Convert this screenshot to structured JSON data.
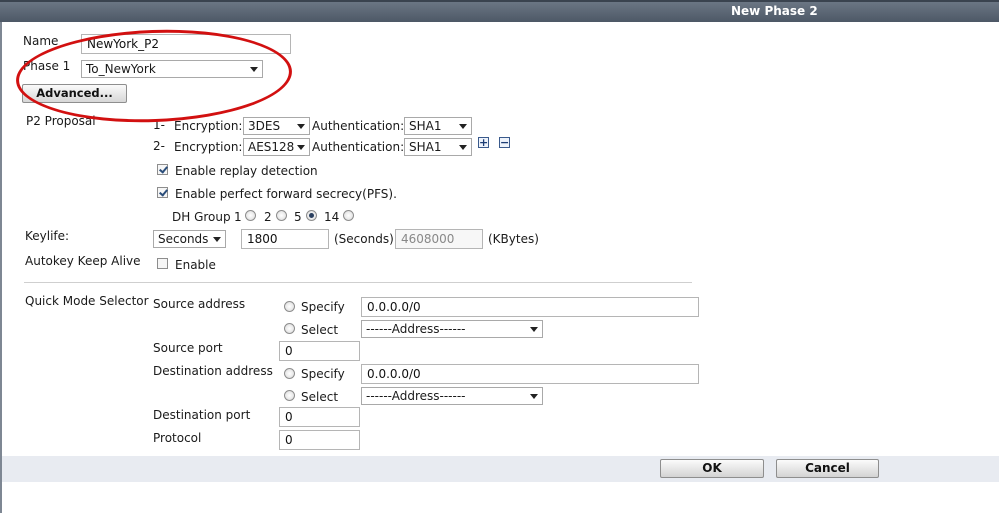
{
  "window": {
    "title": "New Phase 2"
  },
  "name": {
    "label": "Name",
    "value": "NewYork_P2"
  },
  "phase1": {
    "label": "Phase 1",
    "value": "To_NewYork"
  },
  "advanced_button": "Advanced...",
  "p2_proposal": {
    "label": "P2 Proposal",
    "rows": [
      {
        "index": "1-",
        "encryption_label": "Encryption:",
        "encryption": "3DES",
        "auth_label": "Authentication:",
        "auth": "SHA1"
      },
      {
        "index": "2-",
        "encryption_label": "Encryption:",
        "encryption": "AES128",
        "auth_label": "Authentication:",
        "auth": "SHA1"
      }
    ],
    "add_icon": "plus-box-icon",
    "remove_icon": "minus-box-icon"
  },
  "replay": {
    "label": "Enable replay detection",
    "checked": true
  },
  "pfs": {
    "label": "Enable perfect forward secrecy(PFS).",
    "checked": true
  },
  "dh_group": {
    "label": "DH Group",
    "options": [
      "1",
      "2",
      "5",
      "14"
    ],
    "selected": "5"
  },
  "keylife": {
    "label": "Keylife:",
    "unit": "Seconds",
    "seconds_value": "1800",
    "seconds_label": "(Seconds)",
    "kbytes_value": "4608000",
    "kbytes_label": "(KBytes)"
  },
  "autokey": {
    "label": "Autokey Keep Alive",
    "option_label": "Enable",
    "checked": false
  },
  "quick_mode": {
    "label": "Quick Mode Selector",
    "source_address": {
      "label": "Source address",
      "specify_label": "Specify",
      "specify_value": "0.0.0.0/0",
      "select_label": "Select",
      "select_value": "------Address------"
    },
    "source_port": {
      "label": "Source port",
      "value": "0"
    },
    "destination_address": {
      "label": "Destination address",
      "specify_label": "Specify",
      "specify_value": "0.0.0.0/0",
      "select_label": "Select",
      "select_value": "------Address------"
    },
    "destination_port": {
      "label": "Destination port",
      "value": "0"
    },
    "protocol": {
      "label": "Protocol",
      "value": "0"
    }
  },
  "footer": {
    "ok": "OK",
    "cancel": "Cancel"
  },
  "annotation": {
    "color": "#d21010",
    "shape": "ellipse"
  }
}
